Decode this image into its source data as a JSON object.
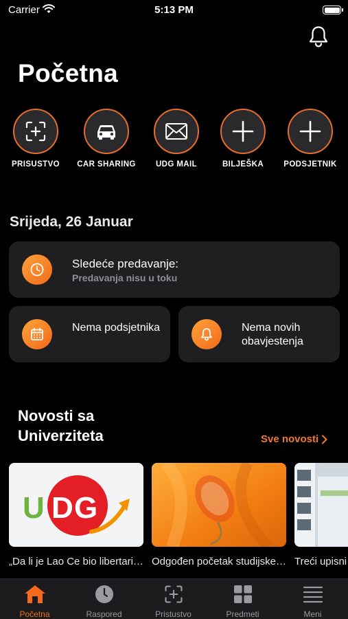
{
  "status_bar": {
    "carrier": "Carrier",
    "time": "5:13 PM"
  },
  "header": {
    "title": "Početna",
    "bell_icon": "bell-icon"
  },
  "quick_actions": [
    {
      "label": "PRISUSTVO",
      "icon": "attendance-scan-icon"
    },
    {
      "label": "CAR SHARING",
      "icon": "car-icon"
    },
    {
      "label": "UDG MAIL",
      "icon": "mail-icon"
    },
    {
      "label": "BILJEŠKA",
      "icon": "plus-icon"
    },
    {
      "label": "PODSJETNIK",
      "icon": "plus-icon"
    }
  ],
  "date_heading": "Srijeda, 26 Januar",
  "cards": {
    "lecture": {
      "title": "Sledeće predavanje:",
      "subtitle": "Predavanja nisu u toku",
      "icon": "clock-icon"
    },
    "reminders": {
      "text": "Nema podsjetnika",
      "icon": "calendar-icon"
    },
    "notifications": {
      "text": "Nema novih obavjestenja",
      "icon": "bell-icon"
    }
  },
  "news": {
    "title": "Novosti sa Univerziteta",
    "see_all": "Sve novosti",
    "items": [
      {
        "caption": "„Da li je Lao Ce bio libertarijanac?“",
        "logo_text": "UDG"
      },
      {
        "caption": "Odgođen početak studijske godine"
      },
      {
        "caption": "Treći upisni rok"
      }
    ]
  },
  "tab_bar": {
    "tabs": [
      {
        "label": "Početna",
        "icon": "home-icon",
        "active": true
      },
      {
        "label": "Raspored",
        "icon": "clock-icon"
      },
      {
        "label": "Pristustvo",
        "icon": "attendance-scan-icon"
      },
      {
        "label": "Predmeti",
        "icon": "grid-icon"
      },
      {
        "label": "Meni",
        "icon": "menu-icon"
      }
    ]
  },
  "colors": {
    "accent": "#F26A1A",
    "background": "#000000",
    "card": "#1F1F21"
  }
}
